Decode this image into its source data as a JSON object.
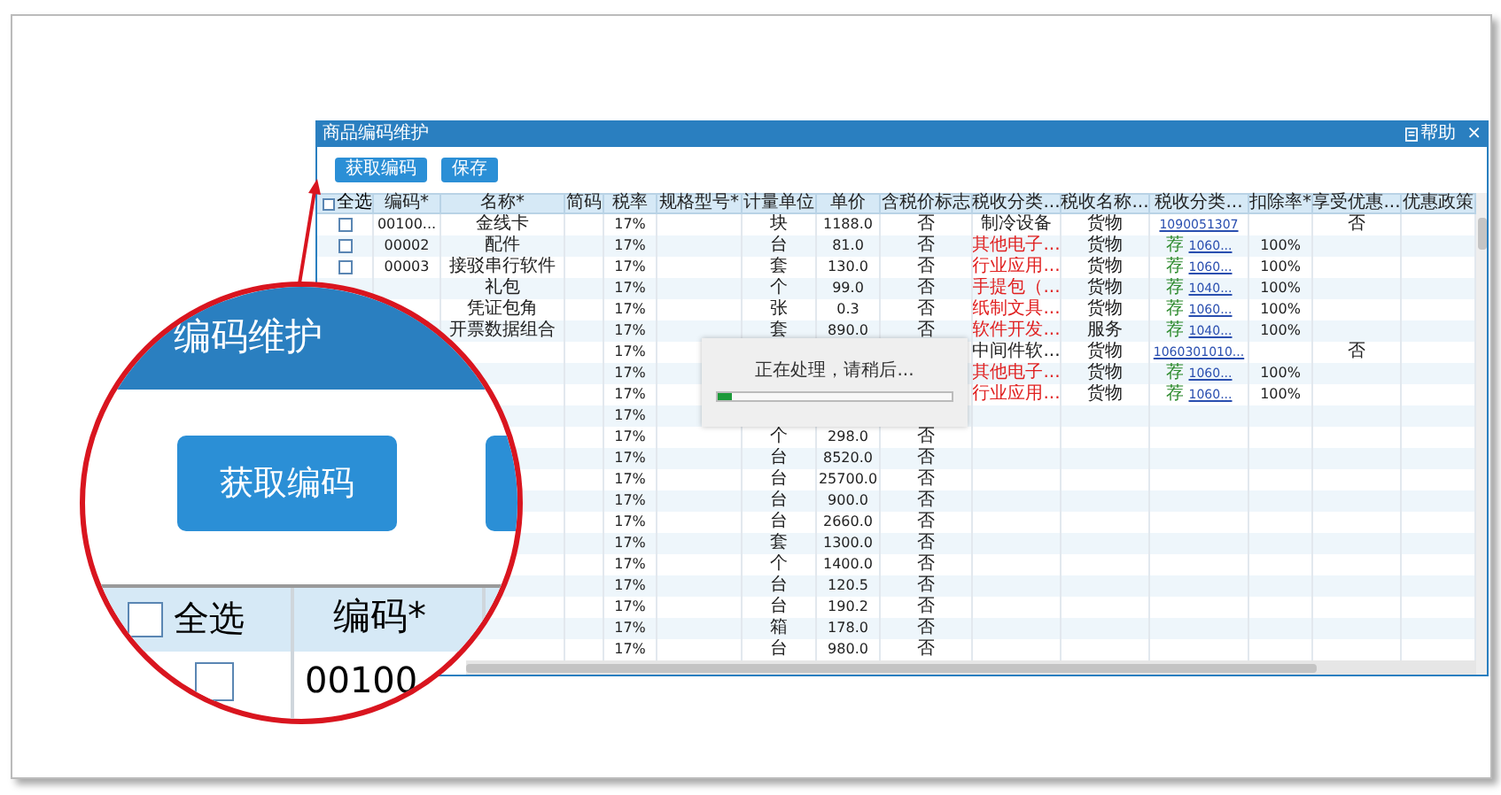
{
  "window": {
    "title": "商品编码维护",
    "help": "帮助",
    "close": "×"
  },
  "toolbar": [
    {
      "label": "获取编码"
    },
    {
      "label": "保存"
    }
  ],
  "table": {
    "select_all": {
      "label": "全选",
      "checked": false
    },
    "columns": [
      "编码*",
      "名称*",
      "简码",
      "税率",
      "规格型号*",
      "计量单位",
      "单价",
      "含税价标志",
      "税收分类...",
      "税收名称...",
      "税收分类...",
      "扣除率*",
      "享受优惠...",
      "优惠政策"
    ],
    "rows": [
      {
        "checked": false,
        "code": "00100...",
        "name": "金线卡",
        "rate": "17%",
        "unit": "块",
        "price": "1188.0",
        "tax_flag": "否",
        "category": "制冷设备",
        "category_red": false,
        "tax_name": "货物",
        "tax_code": "1090051307",
        "preferential": "否"
      },
      {
        "checked": false,
        "code": "00002",
        "name": "配件",
        "rate": "17%",
        "unit": "台",
        "price": "81.0",
        "tax_flag": "否",
        "category": "其他电子...",
        "category_red": true,
        "tax_name": "货物",
        "tag": "荐",
        "tax_code": "1060...",
        "deduction": "100%"
      },
      {
        "checked": false,
        "code": "00003",
        "name": "接驳串行软件",
        "rate": "17%",
        "unit": "套",
        "price": "130.0",
        "tax_flag": "否",
        "category": "行业应用...",
        "category_red": true,
        "tax_name": "货物",
        "tag": "荐",
        "tax_code": "1060...",
        "deduction": "100%"
      },
      {
        "name": "礼包",
        "rate": "17%",
        "unit": "个",
        "price": "99.0",
        "tax_flag": "否",
        "category": "手提包（...",
        "category_red": true,
        "tax_name": "货物",
        "tag": "荐",
        "tax_code": "1040...",
        "deduction": "100%"
      },
      {
        "name": "凭证包角",
        "rate": "17%",
        "unit": "张",
        "price": "0.3",
        "tax_flag": "否",
        "category": "纸制文具...",
        "category_red": true,
        "tax_name": "货物",
        "tag": "荐",
        "tax_code": "1060...",
        "deduction": "100%"
      },
      {
        "name": "开票数据组合",
        "rate": "17%",
        "unit": "套",
        "price": "890.0",
        "tax_flag": "否",
        "category": "软件开发...",
        "category_red": true,
        "tax_name": "服务",
        "tag": "荐",
        "tax_code": "1040...",
        "deduction": "100%"
      },
      {
        "rate": "17%",
        "category": "中间件软...",
        "category_red": false,
        "tax_name": "货物",
        "tax_code": "1060301010...",
        "preferential": "否"
      },
      {
        "rate": "17%",
        "category": "其他电子...",
        "category_red": true,
        "tax_name": "货物",
        "tag": "荐",
        "tax_code": "1060...",
        "deduction": "100%"
      },
      {
        "rate": "17%",
        "category": "行业应用...",
        "category_red": true,
        "tax_name": "货物",
        "tag": "荐",
        "tax_code": "1060...",
        "deduction": "100%"
      },
      {
        "rate": "17%"
      },
      {
        "rate": "17%",
        "unit": "个",
        "price": "298.0",
        "tax_flag": "否"
      },
      {
        "rate": "17%",
        "unit": "台",
        "price": "8520.0",
        "tax_flag": "否"
      },
      {
        "rate": "17%",
        "unit": "台",
        "price": "25700.0",
        "tax_flag": "否"
      },
      {
        "rate": "17%",
        "unit": "台",
        "price": "900.0",
        "tax_flag": "否"
      },
      {
        "rate": "17%",
        "unit": "台",
        "price": "2660.0",
        "tax_flag": "否"
      },
      {
        "rate": "17%",
        "unit": "套",
        "price": "1300.0",
        "tax_flag": "否"
      },
      {
        "rate": "17%",
        "unit": "个",
        "price": "1400.0",
        "tax_flag": "否"
      },
      {
        "rate": "17%",
        "unit": "台",
        "price": "120.5",
        "tax_flag": "否"
      },
      {
        "rate": "17%",
        "unit": "台",
        "price": "190.2",
        "tax_flag": "否"
      },
      {
        "rate": "17%",
        "unit": "箱",
        "price": "178.0",
        "tax_flag": "否"
      },
      {
        "rate": "17%",
        "unit": "台",
        "price": "980.0",
        "tax_flag": "否"
      }
    ]
  },
  "dialog": {
    "message": "正在处理，请稍后...",
    "level": 0.06
  },
  "magnifier": {
    "title": "编码维护",
    "button": "获取编码",
    "select_all": {
      "label": "全选",
      "checked": false
    },
    "column": "编码*",
    "row": {
      "checked": false,
      "code": "00100"
    }
  }
}
